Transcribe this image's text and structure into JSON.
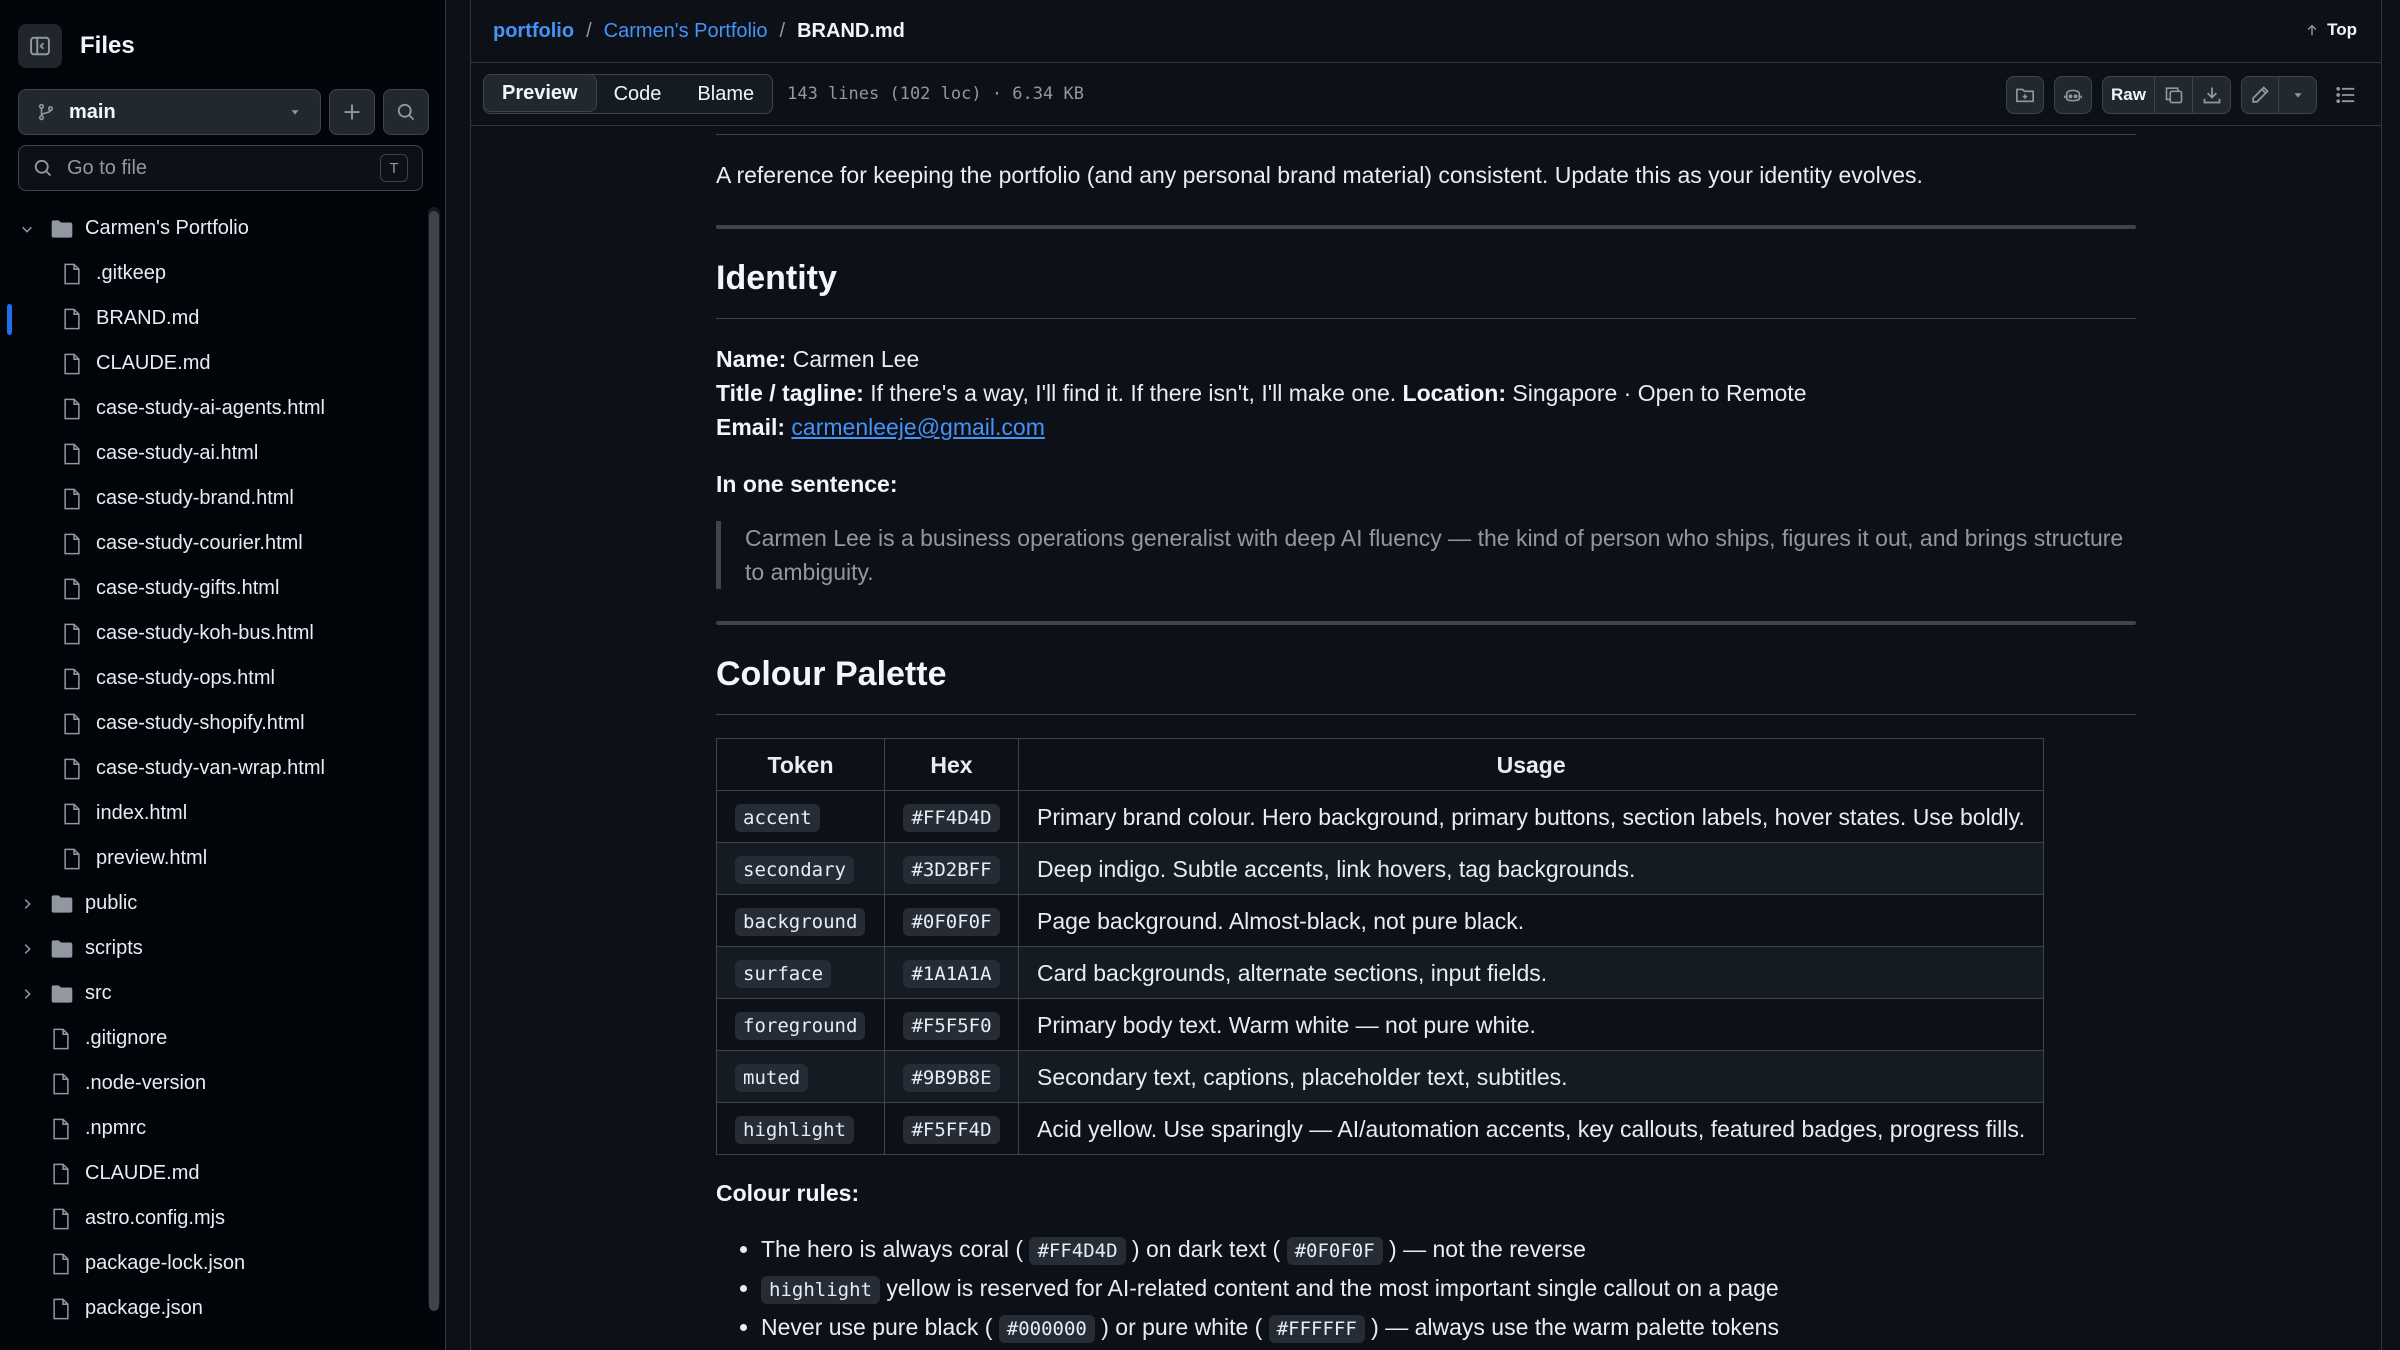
{
  "sidebar": {
    "title": "Files",
    "branch": "main",
    "go_to_file_placeholder": "Go to file",
    "go_to_file_shortcut": "T",
    "tree": [
      {
        "label": "Carmen's Portfolio",
        "type": "folder-open",
        "depth": 0
      },
      {
        "label": ".gitkeep",
        "type": "file",
        "depth": 1
      },
      {
        "label": "BRAND.md",
        "type": "file",
        "depth": 1,
        "active": true
      },
      {
        "label": "CLAUDE.md",
        "type": "file",
        "depth": 1
      },
      {
        "label": "case-study-ai-agents.html",
        "type": "file",
        "depth": 1
      },
      {
        "label": "case-study-ai.html",
        "type": "file",
        "depth": 1
      },
      {
        "label": "case-study-brand.html",
        "type": "file",
        "depth": 1
      },
      {
        "label": "case-study-courier.html",
        "type": "file",
        "depth": 1
      },
      {
        "label": "case-study-gifts.html",
        "type": "file",
        "depth": 1
      },
      {
        "label": "case-study-koh-bus.html",
        "type": "file",
        "depth": 1
      },
      {
        "label": "case-study-ops.html",
        "type": "file",
        "depth": 1
      },
      {
        "label": "case-study-shopify.html",
        "type": "file",
        "depth": 1
      },
      {
        "label": "case-study-van-wrap.html",
        "type": "file",
        "depth": 1
      },
      {
        "label": "index.html",
        "type": "file",
        "depth": 1
      },
      {
        "label": "preview.html",
        "type": "file",
        "depth": 1
      },
      {
        "label": "public",
        "type": "folder",
        "depth": 0
      },
      {
        "label": "scripts",
        "type": "folder",
        "depth": 0
      },
      {
        "label": "src",
        "type": "folder",
        "depth": 0
      },
      {
        "label": ".gitignore",
        "type": "file",
        "depth": 0
      },
      {
        "label": ".node-version",
        "type": "file",
        "depth": 0
      },
      {
        "label": ".npmrc",
        "type": "file",
        "depth": 0
      },
      {
        "label": "CLAUDE.md",
        "type": "file",
        "depth": 0
      },
      {
        "label": "astro.config.mjs",
        "type": "file",
        "depth": 0
      },
      {
        "label": "package-lock.json",
        "type": "file",
        "depth": 0
      },
      {
        "label": "package.json",
        "type": "file",
        "depth": 0
      }
    ]
  },
  "breadcrumb": {
    "repo": "portfolio",
    "folder": "Carmen's Portfolio",
    "sep": "/",
    "file": "BRAND.md"
  },
  "top_link": "Top",
  "toolbar": {
    "tabs": [
      "Preview",
      "Code",
      "Blame"
    ],
    "active_tab": "Preview",
    "file_info": "143 lines (102 loc) · 6.34 KB",
    "raw_label": "Raw"
  },
  "doc": {
    "intro": "A reference for keeping the portfolio (and any personal brand material) consistent. Update this as your identity evolves.",
    "identity_heading": "Identity",
    "name_label": "Name:",
    "name_value": " Carmen Lee",
    "tagline_label": "Title / tagline:",
    "tagline_value": " If there's a way, I'll find it. If there isn't, I'll make one. ",
    "location_label": "Location:",
    "location_value": " Singapore · Open to Remote",
    "email_label": "Email:",
    "email_value": "carmenleeje@gmail.com",
    "one_sentence_label": "In one sentence:",
    "quote": "Carmen Lee is a business operations generalist with deep AI fluency — the kind of person who ships, figures it out, and brings structure to ambiguity.",
    "palette_heading": "Colour Palette",
    "table_headers": [
      "Token",
      "Hex",
      "Usage"
    ],
    "table_rows": [
      {
        "token": "accent",
        "hex": "#FF4D4D",
        "usage": "Primary brand colour. Hero background, primary buttons, section labels, hover states. Use boldly."
      },
      {
        "token": "secondary",
        "hex": "#3D2BFF",
        "usage": "Deep indigo. Subtle accents, link hovers, tag backgrounds."
      },
      {
        "token": "background",
        "hex": "#0F0F0F",
        "usage": "Page background. Almost-black, not pure black."
      },
      {
        "token": "surface",
        "hex": "#1A1A1A",
        "usage": "Card backgrounds, alternate sections, input fields."
      },
      {
        "token": "foreground",
        "hex": "#F5F5F0",
        "usage": "Primary body text. Warm white — not pure white."
      },
      {
        "token": "muted",
        "hex": "#9B9B8E",
        "usage": "Secondary text, captions, placeholder text, subtitles."
      },
      {
        "token": "highlight",
        "hex": "#F5FF4D",
        "usage": "Acid yellow. Use sparingly — AI/automation accents, key callouts, featured badges, progress fills."
      }
    ],
    "rules_label": "Colour rules:",
    "rules": [
      {
        "t1": "The hero is always coral (",
        "c1": "#FF4D4D",
        "t2": ") on dark text (",
        "c2": "#0F0F0F",
        "t3": ") — not the reverse"
      },
      {
        "t1": "",
        "c1": "highlight",
        "t2": " yellow is reserved for AI-related content and the most important single callout on a page",
        "c2": "",
        "t3": ""
      },
      {
        "t1": "Never use pure black (",
        "c1": "#000000",
        "t2": ") or pure white (",
        "c2": "#FFFFFF",
        "t3": ") — always use the warm palette tokens"
      }
    ]
  },
  "colors": {
    "link": "#4493f8",
    "active_indicator": "#1f6feb",
    "background": "#0d1117"
  }
}
